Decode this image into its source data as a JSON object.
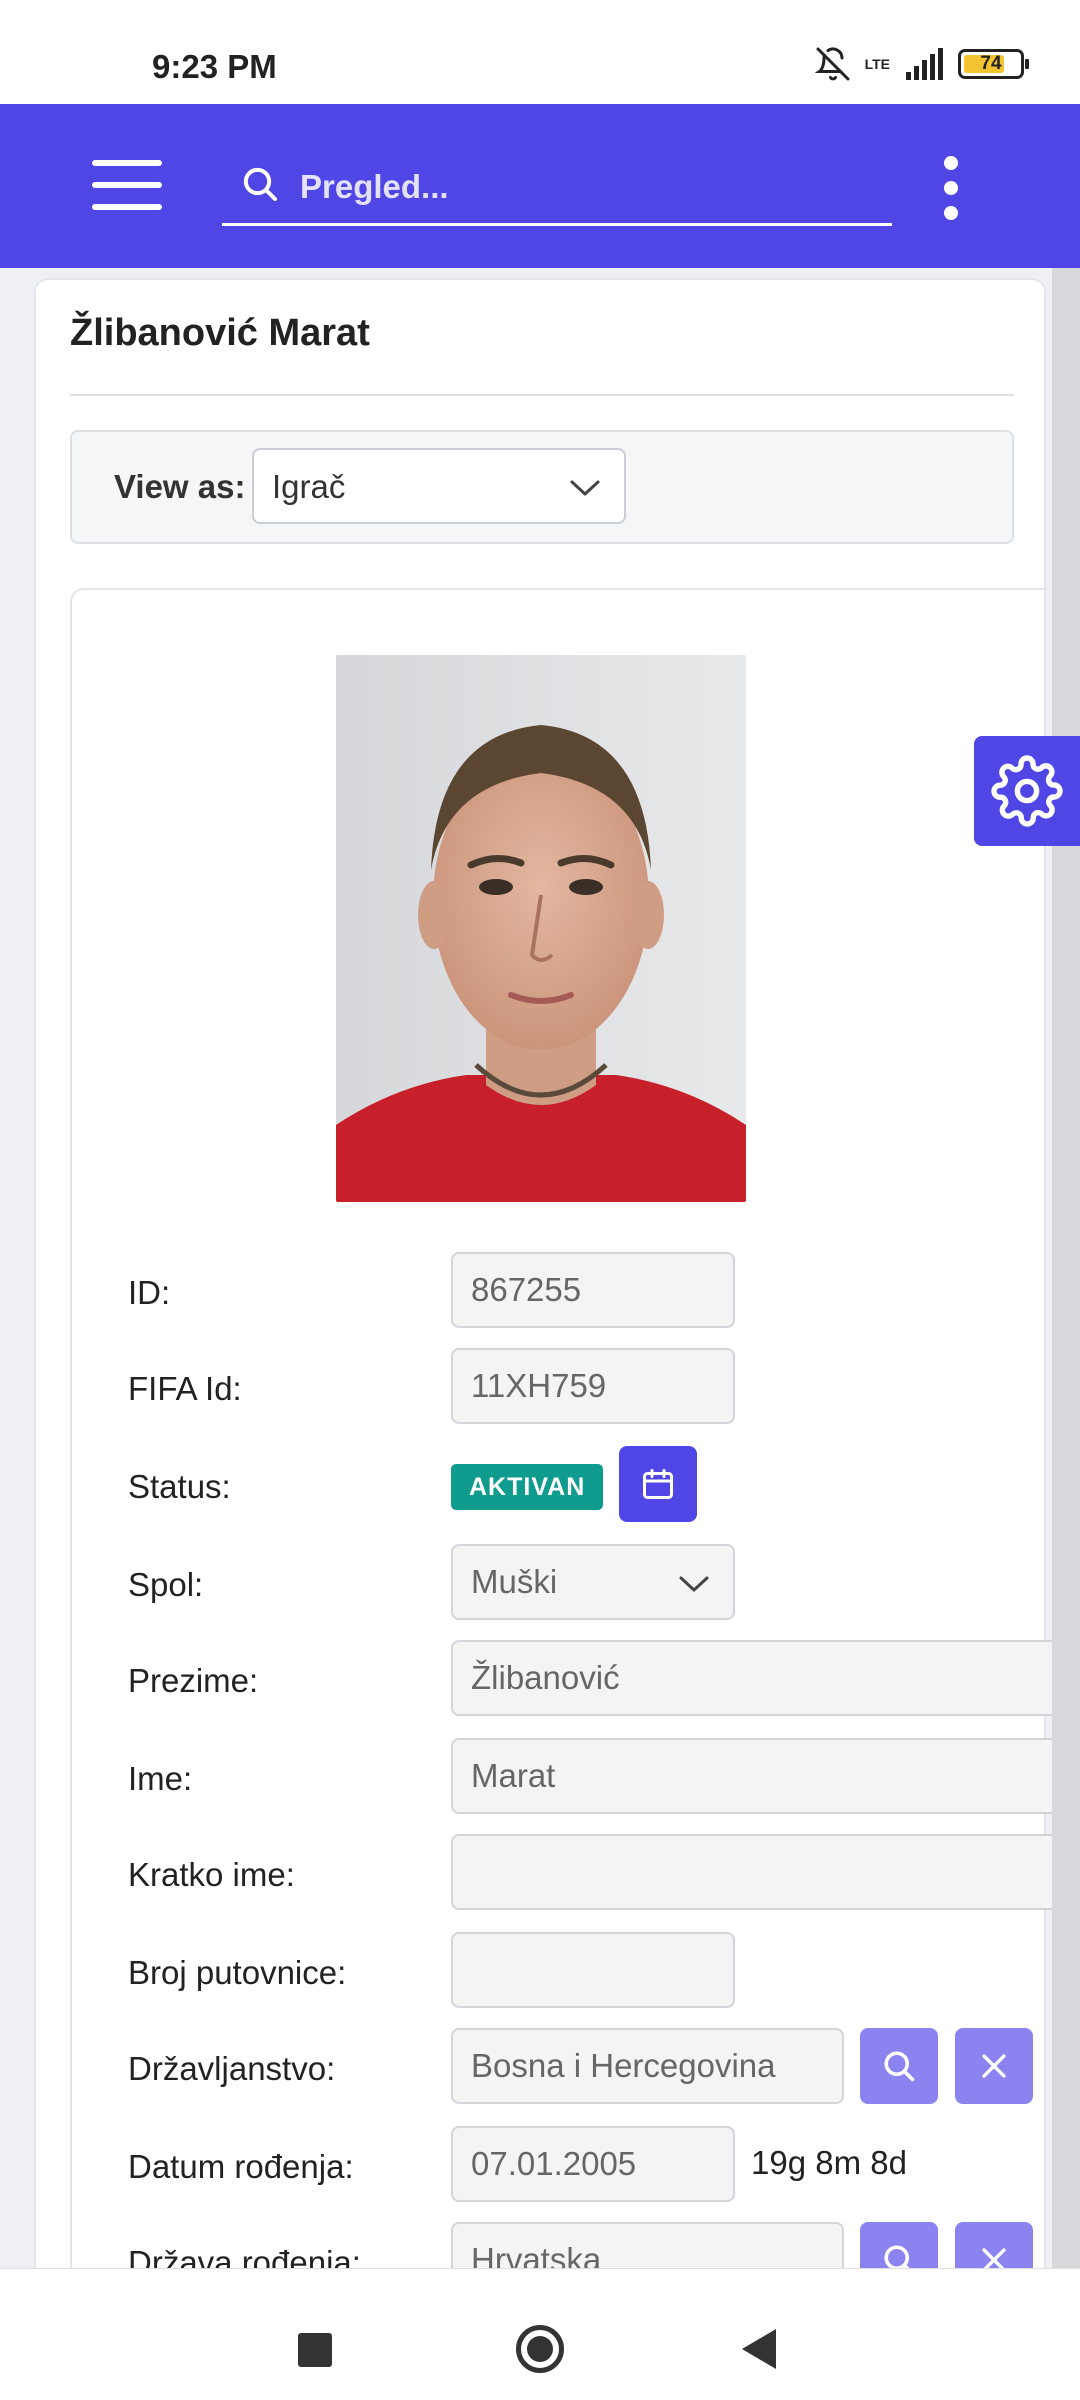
{
  "status_bar": {
    "time": "9:23 PM",
    "network": "LTE",
    "battery": "74",
    "battery_level": 0.74
  },
  "app_bar": {
    "search_placeholder": "Pregled..."
  },
  "player": {
    "title": "Žlibanović Marat"
  },
  "view_as": {
    "label": "View as:",
    "selected": "Igrač"
  },
  "form": {
    "id": {
      "label": "ID:",
      "value": "867255"
    },
    "fifa_id": {
      "label": "FIFA Id:",
      "value": "11XH759"
    },
    "status": {
      "label": "Status:",
      "badge": "AKTIVAN"
    },
    "spol": {
      "label": "Spol:",
      "value": "Muški"
    },
    "prezime": {
      "label": "Prezime:",
      "value": "Žlibanović"
    },
    "ime": {
      "label": "Ime:",
      "value": "Marat"
    },
    "kratko_ime": {
      "label": "Kratko ime:",
      "value": ""
    },
    "broj_putovnice": {
      "label": "Broj putovnice:",
      "value": ""
    },
    "drzavljanstvo": {
      "label": "Državljanstvo:",
      "value": "Bosna i Hercegovina"
    },
    "datum_rodjenja": {
      "label": "Datum rođenja:",
      "value": "07.01.2005",
      "age": "19g 8m 8d"
    },
    "drzava_rodjenja": {
      "label": "Država rođenja:",
      "value": "Hrvatska"
    }
  },
  "colors": {
    "primary": "#4f46e5",
    "primary_light": "#8b83f0",
    "status_active": "#0f9b8e"
  }
}
